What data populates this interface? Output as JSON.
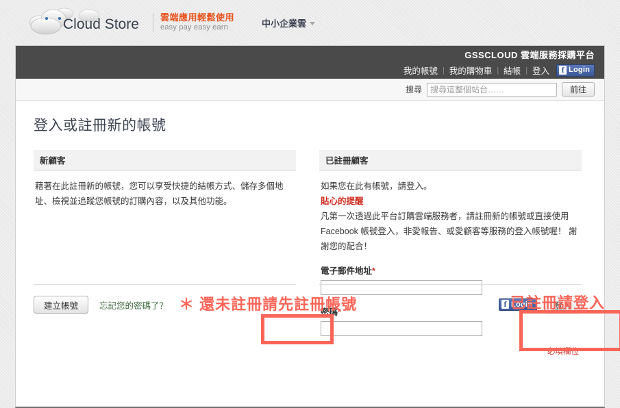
{
  "branding": {
    "logo_text": "Cloud Store",
    "logo_icon": "cloud-icon",
    "tagline_cn": "雲端應用輕鬆使用",
    "tagline_en": "easy pay easy earn",
    "header_menu_label": "中小企業雲",
    "header_menu_icon": "chevron-down-icon"
  },
  "topnav": {
    "brand_title": "GSSCLOUD 雲端服務採購平台",
    "links": [
      {
        "label": "我的帳號"
      },
      {
        "label": "我的購物車"
      },
      {
        "label": "結帳"
      },
      {
        "label": "登入"
      }
    ],
    "separator": "|",
    "facebook": {
      "icon": "facebook-f-icon",
      "label": "Login"
    }
  },
  "search": {
    "label": "搜尋",
    "placeholder": "搜尋這整個站台……",
    "value": "",
    "button": "前往",
    "icon": "search-icon"
  },
  "main": {
    "page_title": "登入或註冊新的帳號",
    "new_customer": {
      "heading": "新顧客",
      "body": "藉著在此註冊新的帳號，您可以享受快捷的結帳方式、儲存多個地址、檢視並追蹤您帳號的訂購內容，以及其他功能。",
      "create_button": "建立帳號",
      "forgot_link": "忘記您的密碼了？"
    },
    "registered_customer": {
      "heading": "已註冊顧客",
      "intro": "如果您在此有帳號，請登入。",
      "notice_title": "貼心的提醒",
      "notice_body": "凡第一次透過此平台訂購雲端服務者，請註冊新的帳號或直接使用 Facebook 帳號登入，非愛報告、或愛顧客等服務的登入帳號喔！ 謝謝您的配合！",
      "email_label": "電子郵件地址",
      "password_label": "密碼",
      "required_mark": "*",
      "required_note": "* 必填欄位",
      "email_value": "",
      "password_value": "",
      "facebook_icon": "facebook-f-icon",
      "facebook_label": "Login",
      "login_button": "登入"
    }
  },
  "annotations": {
    "left": "＊ 還未註冊請先註冊帳號",
    "right": "已註冊請登入",
    "color": "#fb6558"
  },
  "colors": {
    "dark_nav": "#4a4a4a",
    "accent_orange": "#e8541e",
    "notice_red": "#cf2b1d",
    "annotation_red": "#fb6558",
    "facebook_blue": "#3b5998"
  }
}
